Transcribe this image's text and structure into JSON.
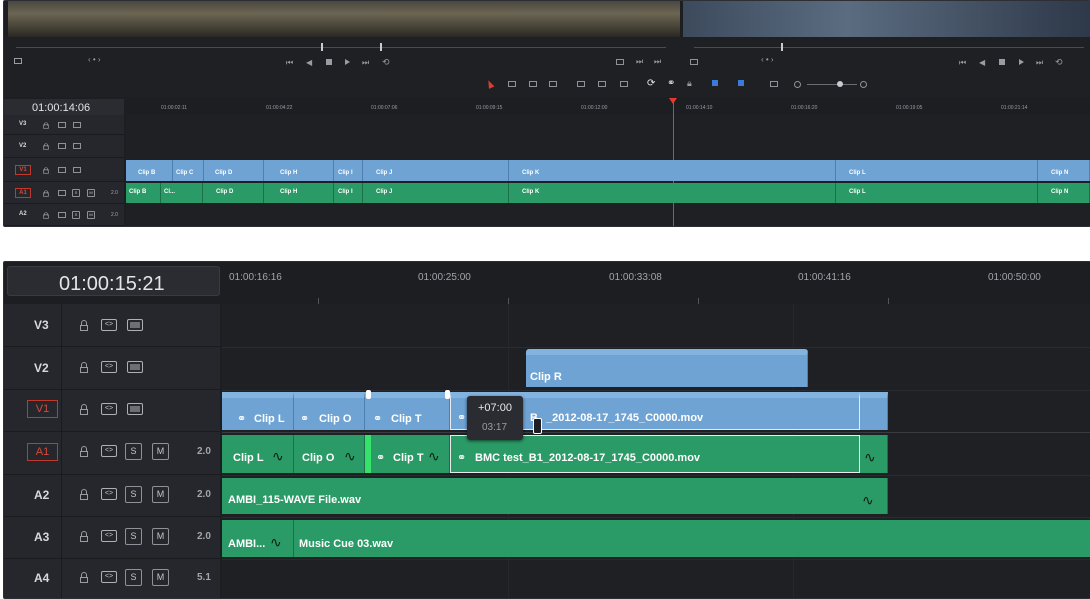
{
  "top": {
    "timecode": "01:00:14:06",
    "ruler": [
      "01:00:02:11",
      "01:00:04:22",
      "01:00:07:06",
      "01:00:09:15",
      "01:00:12:00",
      "01:00:14:10",
      "01:00:16:20",
      "01:00:19:05",
      "01:00:21:14"
    ],
    "tracks": [
      {
        "name": "V3",
        "kind": "video"
      },
      {
        "name": "V2",
        "kind": "video"
      },
      {
        "name": "V1",
        "kind": "video",
        "selected": true
      },
      {
        "name": "A1",
        "kind": "audio",
        "selected": true,
        "level": "2.0"
      },
      {
        "name": "A2",
        "kind": "audio",
        "level": "2.0"
      }
    ],
    "video_clips": [
      "Clip B",
      "Clip C",
      "Clip D",
      "Clip H",
      "Clip I",
      "Clip J",
      "Clip K",
      "Clip L",
      "Clip N"
    ],
    "audio_clips": [
      "Clip B",
      "Cl...",
      "Clip D",
      "Clip H",
      "Clip I",
      "Clip J",
      "Clip K",
      "Clip L",
      "Clip N"
    ],
    "solo_label": "S",
    "mute_label": "M",
    "playhead_color": "#e03b2e"
  },
  "bottom": {
    "timecode": "01:00:15:21",
    "ruler": [
      "01:00:16:16",
      "01:00:25:00",
      "01:00:33:08",
      "01:00:41:16",
      "01:00:50:00"
    ],
    "tracks": [
      {
        "name": "V3",
        "kind": "video"
      },
      {
        "name": "V2",
        "kind": "video"
      },
      {
        "name": "V1",
        "kind": "video",
        "selected": true
      },
      {
        "name": "A1",
        "kind": "audio",
        "selected": true,
        "level": "2.0"
      },
      {
        "name": "A2",
        "kind": "audio",
        "level": "2.0"
      },
      {
        "name": "A3",
        "kind": "audio",
        "level": "2.0"
      },
      {
        "name": "A4",
        "kind": "audio",
        "level": "5.1"
      }
    ],
    "solo_label": "S",
    "mute_label": "M",
    "v2_clip": "Clip R",
    "v1_clips": [
      "Clip L",
      "Clip O",
      "Clip T",
      "B",
      "_2012-08-17_1745_C0000.mov"
    ],
    "a1_clips": [
      "Clip L",
      "Clip O",
      "Clip T",
      "BMC test_B1_2012-08-17_1745_C0000.mov"
    ],
    "a2_clip": "AMBI_115-WAVE File.wav",
    "a3_clips": [
      "AMBI...",
      "Music Cue 03.wav"
    ],
    "tooltip": {
      "offset": "+07:00",
      "duration": "03:17"
    },
    "video_color": "#6ea3d4",
    "audio_color": "#2a9a66"
  }
}
